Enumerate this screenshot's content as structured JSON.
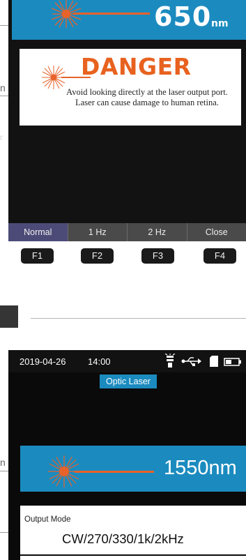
{
  "top_device": {
    "wavelength_value": "650",
    "wavelength_unit": "nm",
    "warning": {
      "title": "DANGER",
      "message": "Avoid looking directly at the laser output port. Laser can cause damage to human retina."
    },
    "softkeys": [
      "Normal",
      "1 Hz",
      "2 Hz",
      "Close"
    ],
    "active_softkey": "Normal",
    "function_keys": [
      "F1",
      "F2",
      "F3",
      "F4"
    ]
  },
  "bottom_device": {
    "status": {
      "date": "2019-04-26",
      "time": "14:00"
    },
    "screen_title": "Optic Laser",
    "wavelength": "1550nm",
    "output_mode": {
      "label": "Output Mode",
      "value": "CW/270/330/1k/2kHz"
    }
  },
  "margin_annotations": [
    "n",
    "n"
  ],
  "colors": {
    "accent_blue": "#1b8bbf",
    "laser_orange": "#e8622a",
    "danger_orange": "#e8621f",
    "softkey_active": "#4c4b78",
    "screen_black": "#121212"
  },
  "icons": [
    "laser-burst-icon",
    "flashlight-icon",
    "usb-icon",
    "sd-card-icon",
    "battery-icon"
  ]
}
